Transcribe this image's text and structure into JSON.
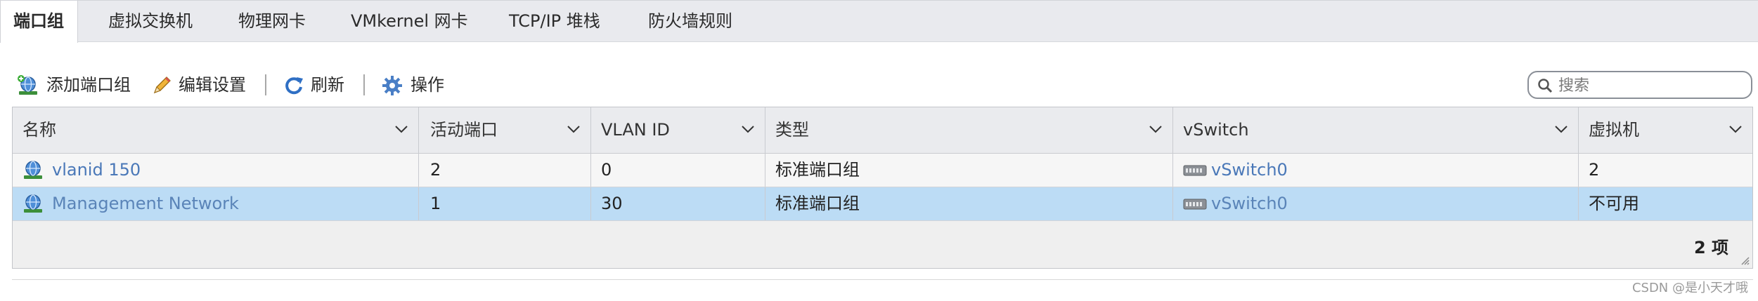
{
  "tabs": [
    {
      "label": "端口组",
      "active": true
    },
    {
      "label": "虚拟交换机",
      "active": false
    },
    {
      "label": "物理网卡",
      "active": false
    },
    {
      "label": "VMkernel 网卡",
      "active": false
    },
    {
      "label": "TCP/IP 堆栈",
      "active": false
    },
    {
      "label": "防火墙规则",
      "active": false
    }
  ],
  "toolbar": {
    "add_port_group": "添加端口组",
    "edit_settings": "编辑设置",
    "refresh": "刷新",
    "actions": "操作",
    "icons": {
      "add_port_group": "add-network-icon",
      "edit_settings": "pencil-icon",
      "refresh": "refresh-icon",
      "actions": "gear-icon"
    }
  },
  "search": {
    "placeholder": "搜索",
    "value": ""
  },
  "grid": {
    "columns": [
      "名称",
      "活动端口",
      "VLAN ID",
      "类型",
      "vSwitch",
      "虚拟机"
    ],
    "rows": [
      {
        "name": "vlanid 150",
        "active_ports": "2",
        "vlan_id": "0",
        "type": "标准端口组",
        "vswitch": "vSwitch0",
        "vms": "2",
        "selected": false
      },
      {
        "name": "Management Network",
        "active_ports": "1",
        "vlan_id": "30",
        "type": "标准端口组",
        "vswitch": "vSwitch0",
        "vms": "不可用",
        "selected": true
      }
    ],
    "count": "2 项"
  },
  "watermark": "CSDN @是小天才哦",
  "colors": {
    "accent_link": "#4a78b8",
    "selected_row": "#bcdcf5",
    "tabbar_bg": "#e9eaee",
    "header_bg": "#eaebee"
  }
}
